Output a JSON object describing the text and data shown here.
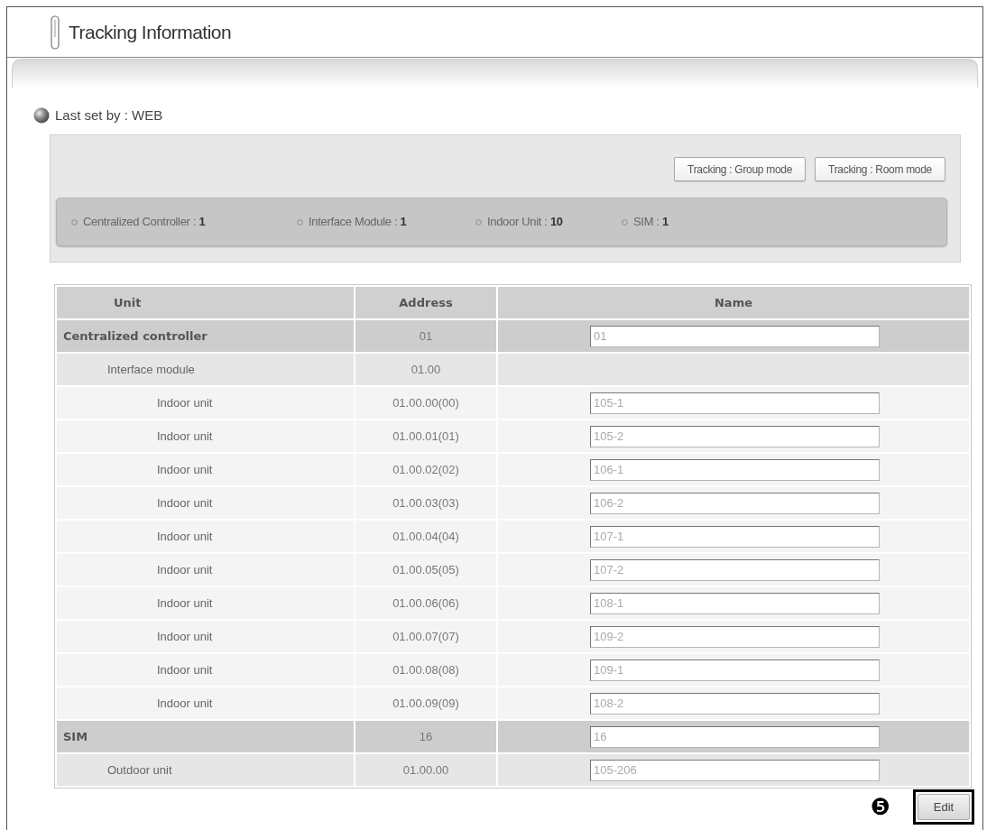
{
  "page": {
    "title": "Tracking Information"
  },
  "last_set_by": "Last set by : WEB",
  "mode_buttons": [
    "Tracking : Group mode",
    "Tracking : Room mode"
  ],
  "summary": [
    "Centralized Controller : **1**",
    "Interface Module : **1**",
    "Indoor Unit : **10**",
    "SIM : **1**"
  ],
  "table": {
    "columns": [
      "Unit",
      "Address",
      "Name"
    ],
    "rows": [
      {
        "unit": "Centralized controller",
        "address": "01",
        "name": "01",
        "children": [
          {
            "unit": "Interface module",
            "address": "01.00",
            "children": [
              {
                "unit": "Indoor unit",
                "address": "01.00.00(00)",
                "name": "105-1"
              },
              {
                "unit": "Indoor unit",
                "address": "01.00.01(01)",
                "name": "105-2"
              },
              {
                "unit": "Indoor unit",
                "address": "01.00.02(02)",
                "name": "106-1"
              },
              {
                "unit": "Indoor unit",
                "address": "01.00.03(03)",
                "name": "106-2"
              },
              {
                "unit": "Indoor unit",
                "address": "01.00.04(04)",
                "name": "107-1"
              },
              {
                "unit": "Indoor unit",
                "address": "01.00.05(05)",
                "name": "107-2"
              },
              {
                "unit": "Indoor unit",
                "address": "01.00.06(06)",
                "name": "108-1"
              },
              {
                "unit": "Indoor unit",
                "address": "01.00.07(07)",
                "name": "109-2"
              },
              {
                "unit": "Indoor unit",
                "address": "01.00.08(08)",
                "name": "109-1"
              },
              {
                "unit": "Indoor unit",
                "address": "01.00.09(09)",
                "name": "108-2"
              }
            ]
          }
        ]
      },
      {
        "unit": "SIM",
        "address": "16",
        "name": "16",
        "children": [
          {
            "unit": "Outdoor unit",
            "address": "01.00.00",
            "name": "105-206"
          }
        ]
      }
    ]
  },
  "callout": "❺",
  "buttons": [
    "Edit"
  ]
}
